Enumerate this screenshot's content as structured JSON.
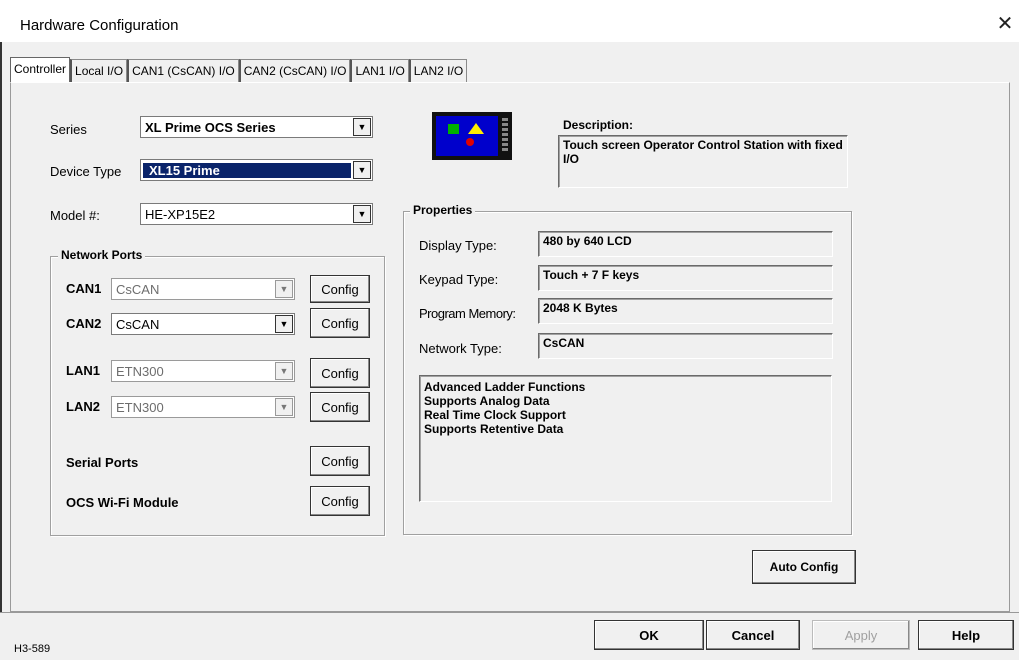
{
  "window": {
    "title": "Hardware Configuration",
    "close_glyph": "✕"
  },
  "tabs": [
    "Controller",
    "Local I/O",
    "CAN1 (CsCAN) I/O",
    "CAN2 (CsCAN) I/O",
    "LAN1 I/O",
    "LAN2 I/O"
  ],
  "controller": {
    "series_label": "Series",
    "series_value": "XL Prime OCS Series",
    "device_type_label": "Device Type",
    "device_type_value": "XL15 Prime",
    "model_label": "Model #:",
    "model_value": "HE-XP15E2"
  },
  "network_ports": {
    "title": "Network Ports",
    "can1_label": "CAN1",
    "can1_value": "CsCAN",
    "can2_label": "CAN2",
    "can2_value": "CsCAN",
    "lan1_label": "LAN1",
    "lan1_value": "ETN300",
    "lan2_label": "LAN2",
    "lan2_value": "ETN300",
    "serial_label": "Serial Ports",
    "wifi_label": "OCS Wi-Fi Module",
    "config_label": "Config"
  },
  "description": {
    "label": "Description:",
    "text": "Touch screen Operator Control Station with fixed I/O"
  },
  "properties": {
    "title": "Properties",
    "display_label": "Display Type:",
    "display_value": "480 by 640 LCD",
    "keypad_label": "Keypad Type:",
    "keypad_value": "Touch + 7 F keys",
    "memory_label": "Program Memory:",
    "memory_value": "2048 K Bytes",
    "network_label": "Network Type:",
    "network_value": "CsCAN",
    "features": [
      "Advanced Ladder Functions",
      "Supports Analog Data",
      "Real Time Clock Support",
      "Supports Retentive Data"
    ]
  },
  "buttons": {
    "auto_config": "Auto Config",
    "ok": "OK",
    "cancel": "Cancel",
    "apply": "Apply",
    "help": "Help"
  },
  "footer": {
    "figure_id": "H3-589"
  },
  "icon_colors": {
    "device_screen": "#0000cc",
    "green": "#00b000",
    "yellow": "#ffee00",
    "red": "#e00000"
  }
}
